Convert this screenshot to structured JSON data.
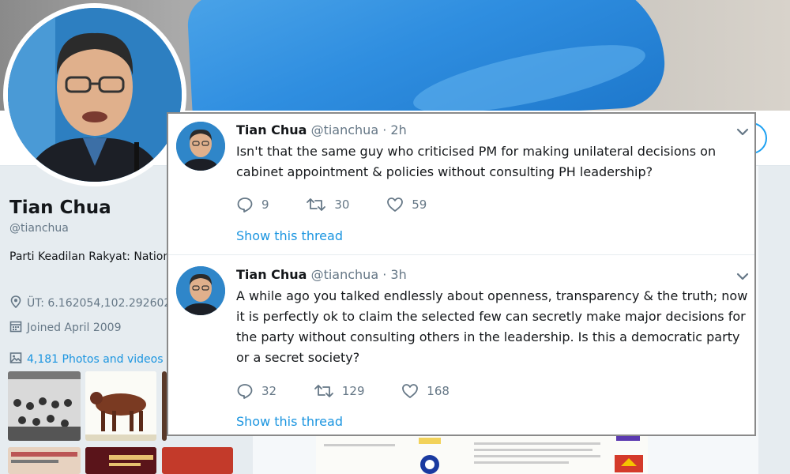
{
  "profile": {
    "name": "Tian Chua",
    "handle": "@tianchua",
    "bio": "Parti Keadilan Rakyat: National Vice President, Member of Parliament",
    "location": "ÜT: 6.162054,102.292602",
    "joined": "Joined April 2009",
    "photos_link": "4,181 Photos and videos"
  },
  "tweets": [
    {
      "name": "Tian Chua",
      "handle": "@tianchua",
      "dot": "·",
      "time": "2h",
      "text": "Isn't that the same guy who criticised PM for making unilateral decisions on cabinet appointment & policies without consulting PH leadership?",
      "replies": "9",
      "retweets": "30",
      "likes": "59",
      "show_thread": "Show this thread"
    },
    {
      "name": "Tian Chua",
      "handle": "@tianchua",
      "dot": "·",
      "time": "3h",
      "text": "A while ago you talked endlessly about openness, transparency & the truth; now it is perfectly ok to claim the selected few can secretly make major decisions for the party without consulting others in the leadership. Is this a democratic party or a secret society?",
      "replies": "32",
      "retweets": "129",
      "likes": "168",
      "show_thread": "Show this thread"
    }
  ],
  "colors": {
    "link": "#1b95e0",
    "muted": "#657786",
    "text": "#14171a"
  }
}
